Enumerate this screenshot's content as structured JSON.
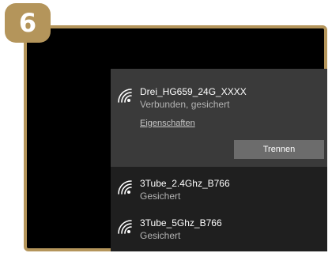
{
  "step_badge": "6",
  "colors": {
    "frame": "#b4955b",
    "panel": "#1f1f1f",
    "connected_bg": "#3a3a3a",
    "button": "#6c6c6c"
  },
  "networks": [
    {
      "ssid": "Drei_HG659_24G_XXXX",
      "status": "Verbunden, gesichert",
      "icon": "wifi-secured-icon",
      "properties_label": "Eigenschaften",
      "action_label": "Trennen"
    },
    {
      "ssid": "3Tube_2.4Ghz_B766",
      "status": "Gesichert",
      "icon": "wifi-secured-icon"
    },
    {
      "ssid": "3Tube_5Ghz_B766",
      "status": "Gesichert",
      "icon": "wifi-secured-icon"
    }
  ]
}
